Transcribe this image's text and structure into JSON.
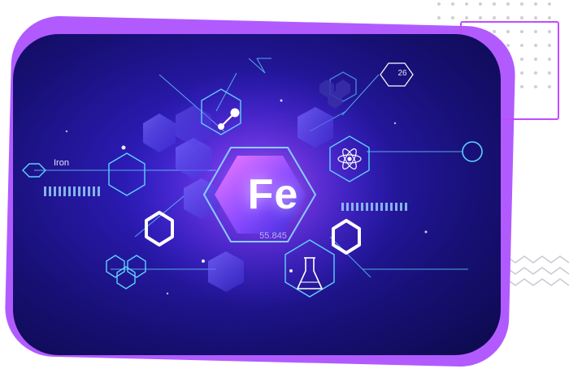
{
  "element": {
    "symbol": "Fe",
    "name": "Iron",
    "atomic_mass": "55.845",
    "atomic_number": "26"
  },
  "icons": [
    "molecule-icon",
    "atom-icon",
    "flask-icon",
    "hexagon-outline-icon"
  ],
  "colors": {
    "accent": "#b15bff",
    "card_center": "#3b28d8",
    "card_edge": "#0c0a4a",
    "line": "#5fd0ff",
    "hex_fill": "#5a4cff"
  }
}
